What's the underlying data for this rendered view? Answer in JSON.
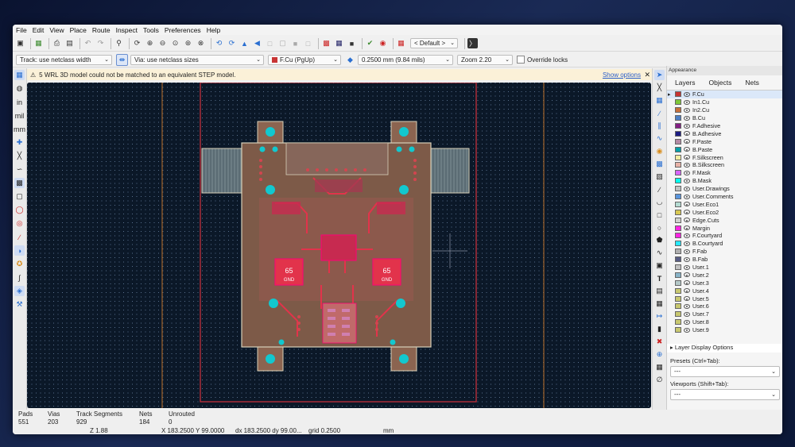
{
  "menu": [
    "File",
    "Edit",
    "View",
    "Place",
    "Route",
    "Inspect",
    "Tools",
    "Preferences",
    "Help"
  ],
  "toolbar1": {
    "icons": [
      "save-icon",
      "board-setup-icon",
      "print-icon",
      "plot-icon",
      "undo-icon",
      "redo-icon",
      "find-icon",
      "refresh-icon",
      "zoom-in-icon",
      "zoom-out-icon",
      "zoom-fit-icon",
      "zoom-selection-icon",
      "zoom-auto-icon",
      "rotate-ccw-icon",
      "rotate-cw-icon",
      "flip-icon",
      "mirror-icon",
      "lock-icon",
      "unlock-icon",
      "netlist-icon",
      "drc-icon",
      "footprint-editor-icon",
      "scripting-icon",
      "3d-viewer-icon",
      "board-stats-icon"
    ],
    "preset_dropdown": "< Default >"
  },
  "toolbar2": {
    "track": "Track: use netclass width",
    "via": "Via: use netclass sizes",
    "layer": "F.Cu (PgUp)",
    "grid": "0.2500 mm (9.84 mils)",
    "zoom": "Zoom 2.20",
    "override_locks": "Override locks"
  },
  "infobar": {
    "message": "5 WRL 3D model could not be matched to an equivalent STEP model.",
    "link": "Show options"
  },
  "panel": {
    "title": "Appearance",
    "tabs": [
      "Layers",
      "Objects",
      "Nets"
    ],
    "layers": [
      {
        "name": "F.Cu",
        "color": "#c83434"
      },
      {
        "name": "In1.Cu",
        "color": "#7fc83a"
      },
      {
        "name": "In2.Cu",
        "color": "#c8703a"
      },
      {
        "name": "B.Cu",
        "color": "#4d7fc4"
      },
      {
        "name": "F.Adhesive",
        "color": "#842084"
      },
      {
        "name": "B.Adhesive",
        "color": "#1d1d84"
      },
      {
        "name": "F.Paste",
        "color": "#b48aa4"
      },
      {
        "name": "B.Paste",
        "color": "#009fa8"
      },
      {
        "name": "F.Silkscreen",
        "color": "#f2eda1"
      },
      {
        "name": "B.Silkscreen",
        "color": "#e8b2a7"
      },
      {
        "name": "F.Mask",
        "color": "#d864ff"
      },
      {
        "name": "B.Mask",
        "color": "#02ffee"
      },
      {
        "name": "User.Drawings",
        "color": "#c2c2c2"
      },
      {
        "name": "User.Comments",
        "color": "#5994dc"
      },
      {
        "name": "User.Eco1",
        "color": "#b4dbd2"
      },
      {
        "name": "User.Eco2",
        "color": "#d8c852"
      },
      {
        "name": "Edge.Cuts",
        "color": "#d0d2cd"
      },
      {
        "name": "Margin",
        "color": "#ff26e2"
      },
      {
        "name": "F.Courtyard",
        "color": "#ff26e2"
      },
      {
        "name": "B.Courtyard",
        "color": "#26e9ff"
      },
      {
        "name": "F.Fab",
        "color": "#afafaf"
      },
      {
        "name": "B.Fab",
        "color": "#585d84"
      },
      {
        "name": "User.1",
        "color": "#c2c2c2"
      },
      {
        "name": "User.2",
        "color": "#89b4c8"
      },
      {
        "name": "User.3",
        "color": "#b4c8c8"
      },
      {
        "name": "User.4",
        "color": "#c8c870"
      },
      {
        "name": "User.5",
        "color": "#c8c870"
      },
      {
        "name": "User.6",
        "color": "#c8c870"
      },
      {
        "name": "User.7",
        "color": "#c8c870"
      },
      {
        "name": "User.8",
        "color": "#c8c870"
      },
      {
        "name": "User.9",
        "color": "#c8c870"
      }
    ],
    "layer_display_options": "Layer Display Options",
    "presets_label": "Presets (Ctrl+Tab):",
    "presets_value": "---",
    "viewports_label": "Viewports (Shift+Tab):",
    "viewports_value": "---"
  },
  "status": {
    "pads_label": "Pads",
    "pads": "551",
    "vias_label": "Vias",
    "vias": "203",
    "tracks_label": "Track Segments",
    "tracks": "929",
    "nets_label": "Nets",
    "nets": "184",
    "unrouted_label": "Unrouted",
    "unrouted": "0",
    "zoom": "Z 1.88",
    "xy": "X 183.2500  Y 99.0000",
    "dxdy": "dx 183.2500  dy 99.00...",
    "grid": "grid 0.2500",
    "units": "mm"
  },
  "board": {
    "left_label": "65",
    "left_sub": "GND",
    "right_label": "65",
    "right_sub": "GND"
  }
}
